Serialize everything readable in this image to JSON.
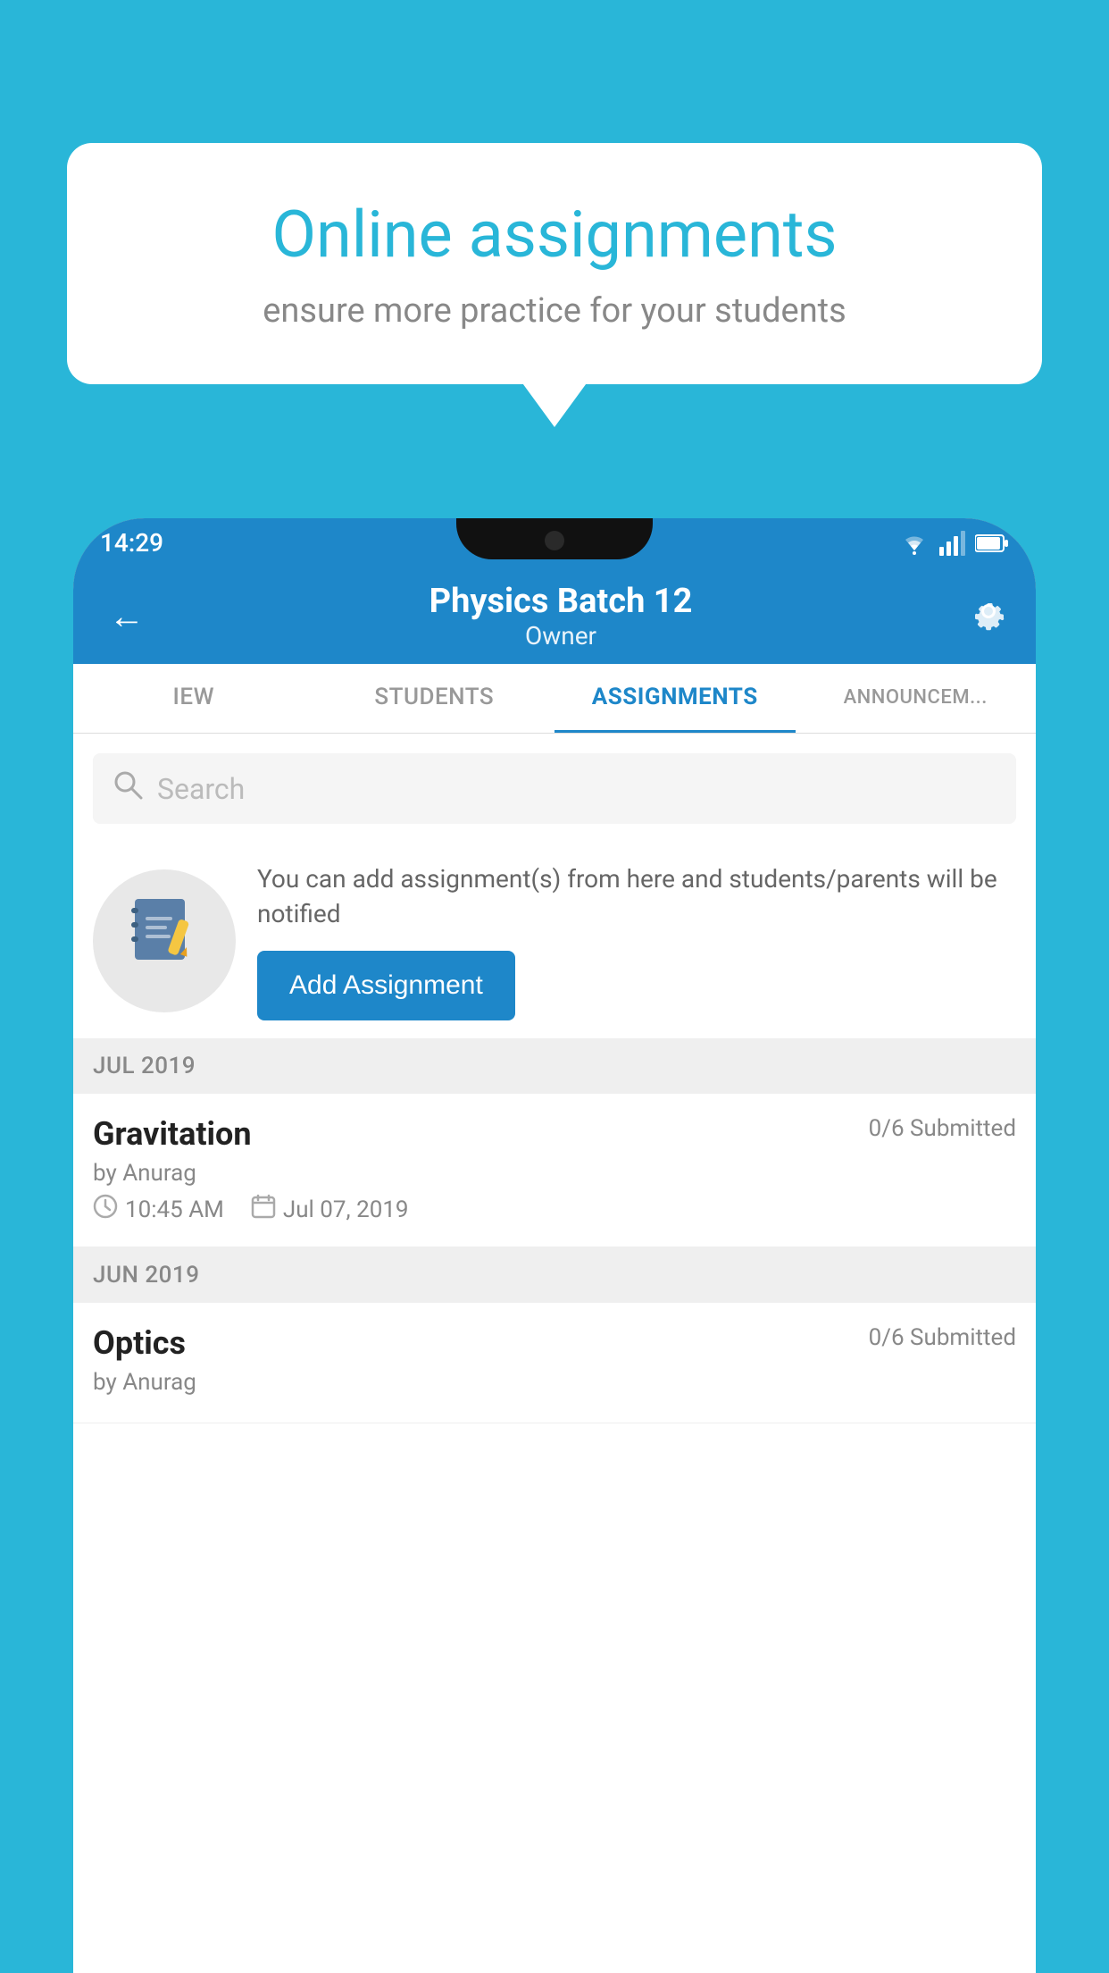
{
  "background": {
    "color": "#29B6D8"
  },
  "speech_bubble": {
    "title": "Online assignments",
    "subtitle": "ensure more practice for your students"
  },
  "status_bar": {
    "time": "14:29",
    "wifi": "wifi",
    "signal": "signal",
    "battery": "battery"
  },
  "app_bar": {
    "back_label": "←",
    "title": "Physics Batch 12",
    "subtitle": "Owner",
    "settings_label": "⚙"
  },
  "tabs": [
    {
      "label": "IEW",
      "active": false
    },
    {
      "label": "STUDENTS",
      "active": false
    },
    {
      "label": "ASSIGNMENTS",
      "active": true
    },
    {
      "label": "ANNOUNCEM...",
      "active": false
    }
  ],
  "search": {
    "placeholder": "Search"
  },
  "info_card": {
    "description": "You can add assignment(s) from here and students/parents will be notified",
    "button_label": "Add Assignment"
  },
  "sections": [
    {
      "header": "JUL 2019",
      "assignments": [
        {
          "name": "Gravitation",
          "submitted": "0/6 Submitted",
          "by": "by Anurag",
          "time": "10:45 AM",
          "date": "Jul 07, 2019"
        }
      ]
    },
    {
      "header": "JUN 2019",
      "assignments": [
        {
          "name": "Optics",
          "submitted": "0/6 Submitted",
          "by": "by Anurag",
          "time": "",
          "date": ""
        }
      ]
    }
  ]
}
